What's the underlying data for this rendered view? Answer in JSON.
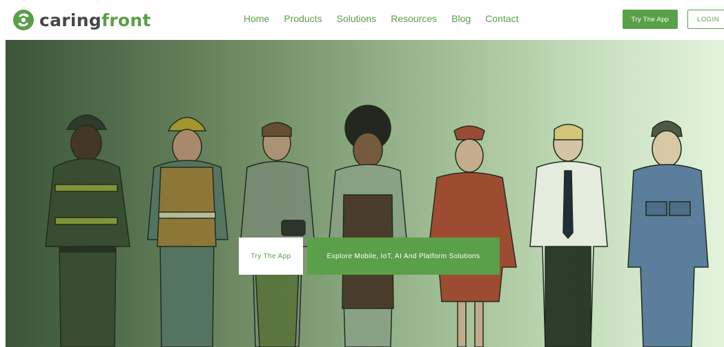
{
  "brand": {
    "name_prefix": "caring",
    "name_suffix": "front",
    "logo_icon": "recycle-leaf-icon"
  },
  "nav": {
    "items": [
      {
        "label": "Home"
      },
      {
        "label": "Products"
      },
      {
        "label": "Solutions"
      },
      {
        "label": "Resources"
      },
      {
        "label": "Blog"
      },
      {
        "label": "Contact"
      }
    ]
  },
  "header_actions": {
    "try_label": "Try The App",
    "login_label": "LOGIN"
  },
  "hero": {
    "try_label": "Try The App",
    "explore_label": "Explore Mobile, IoT, AI And Platform Solutions",
    "illustration": "workers-lineup"
  },
  "colors": {
    "accent": "#5aa048",
    "dark_text": "#444a43",
    "hero_left": "#3f5a3d",
    "hero_right": "#e2f3dc"
  }
}
